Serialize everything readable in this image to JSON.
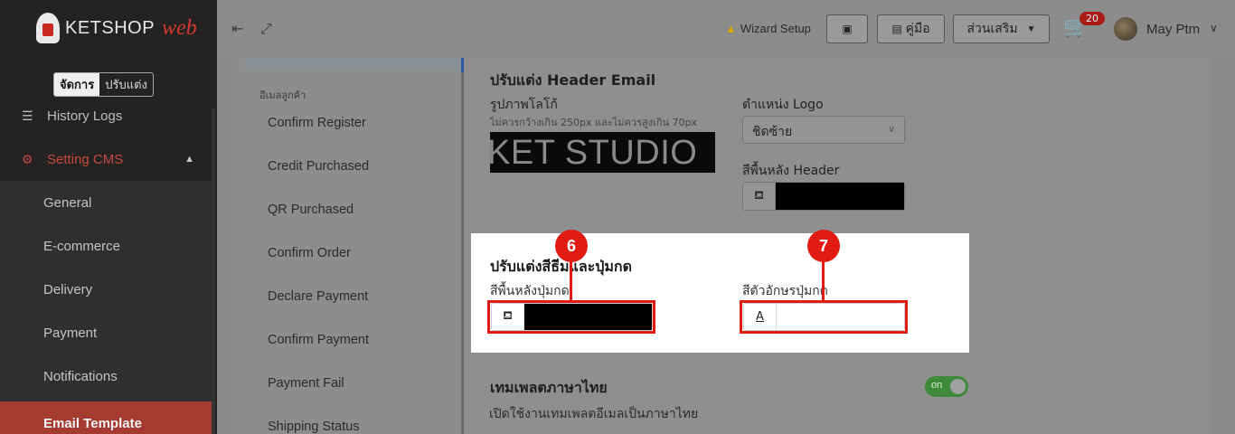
{
  "brand": {
    "name": "KETSHOP",
    "suffix": "web"
  },
  "mode_toggle": {
    "manage": "จัดการ",
    "customize": "ปรับแต่ง"
  },
  "sidebar": {
    "history": "History Logs",
    "setting_cms": "Setting CMS",
    "subitems": [
      "General",
      "E-commerce",
      "Delivery",
      "Payment",
      "Notifications",
      "Email Template"
    ]
  },
  "topbar": {
    "wizard": "Wizard Setup",
    "manual": "คู่มือ",
    "addons": "ส่วนเสริม",
    "cart_count": "20",
    "user": "May Ptm"
  },
  "email_list": {
    "section": "อีเมลลูกค้า",
    "items": [
      "Confirm Register",
      "Credit Purchased",
      "QR Purchased",
      "Confirm Order",
      "Declare Payment",
      "Confirm Payment",
      "Payment Fail",
      "Shipping Status"
    ]
  },
  "header_email": {
    "title": "ปรับแต่ง Header Email",
    "logo_label": "รูปภาพโลโก้",
    "logo_hint": "ไม่ควรกว้างเกิน 250px และไม่ควรสูงเกิน 70px",
    "logo_text": "KET STUDIO",
    "logo_position_label": "ตำแหน่ง Logo",
    "logo_position_value": "ชิดซ้าย",
    "header_bg_label": "สีพื้นหลัง Header",
    "header_bg_color": "#000000"
  },
  "button_colors": {
    "title": "ปรับแต่งสีธีมและปุ่มกด",
    "bg_label": "สีพื้นหลังปุ่มกด",
    "bg_color": "#000000",
    "text_label": "สีตัวอักษรปุ่มกด",
    "text_color": "#ffffff",
    "text_icon": "A"
  },
  "annotations": {
    "marker_6": "6",
    "marker_7": "7"
  },
  "thai_template": {
    "title": "เทมเพลตภาษาไทย",
    "desc": "เปิดใช้งานเทมเพลตอีเมลเป็นภาษาไทย",
    "switch_label": "on"
  },
  "colors": {
    "highlight": "#e01b12",
    "active_menu": "#a53a30",
    "switch_on": "#3f8a3a"
  }
}
